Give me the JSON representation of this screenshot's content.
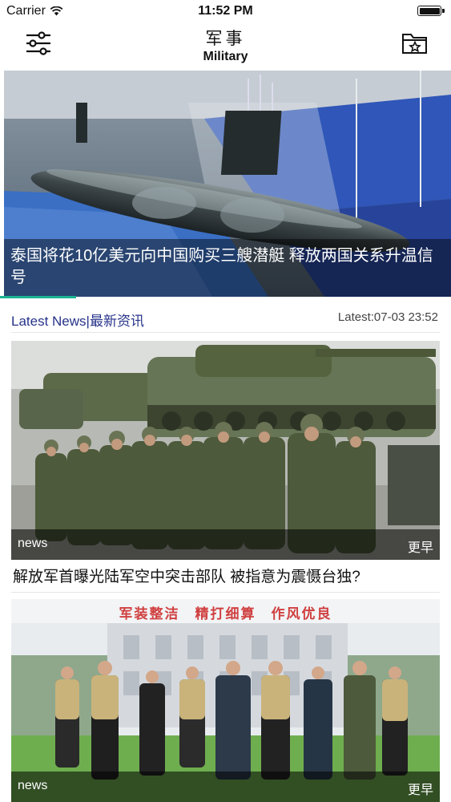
{
  "status_bar": {
    "carrier": "Carrier",
    "time": "11:52 PM"
  },
  "nav": {
    "title": "军事",
    "subtitle": "Military",
    "left_icon": "filter-sliders-icon",
    "right_icon": "folder-star-icon"
  },
  "hero": {
    "caption": "泰国将花10亿美元向中国购买三艘潜艇 释放两国关系升温信号"
  },
  "latest": {
    "label": "Latest News|最新资讯",
    "timestamp": "Latest:07-03 23:52"
  },
  "news": [
    {
      "tag": "news",
      "more": "更早",
      "title": "解放军首曝光陆军空中突击部队 被指意为震慑台独?"
    },
    {
      "tag": "news",
      "more": "更早",
      "banner": "军装整洁　精打细算　作风优良"
    }
  ],
  "colors": {
    "accent": "#1ab394",
    "latest_label": "#27338a"
  }
}
